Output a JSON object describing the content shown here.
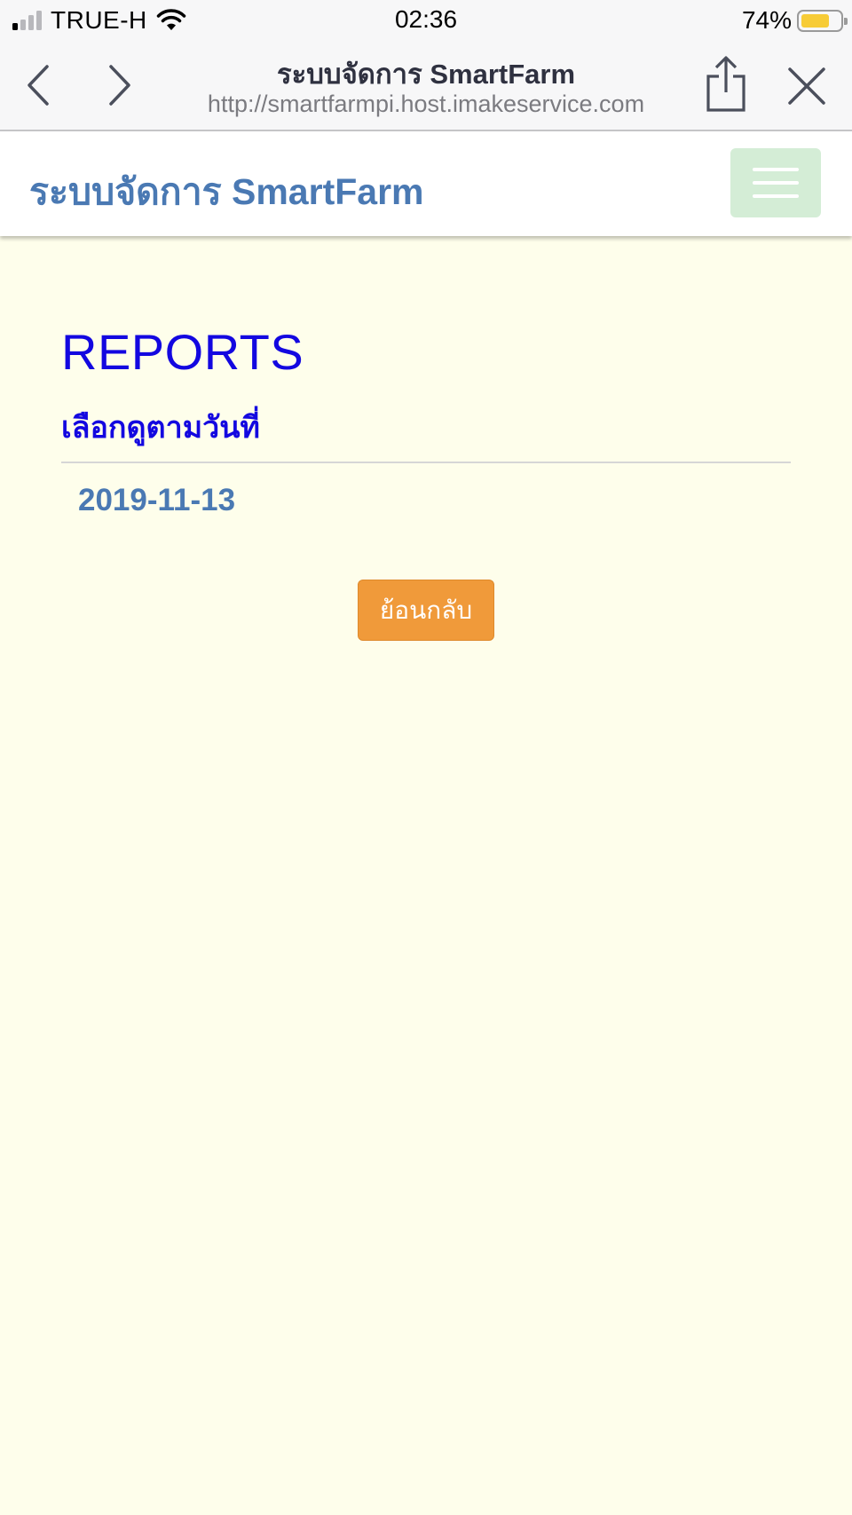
{
  "status_bar": {
    "carrier": "TRUE-H",
    "time": "02:36",
    "battery_percent": "74%",
    "battery_level": 0.74,
    "signal_bars_active": 1,
    "signal_bars_total": 4,
    "icons": [
      "signal-icon",
      "wifi-icon",
      "battery-icon"
    ]
  },
  "browser": {
    "title": "ระบบจัดการ SmartFarm",
    "url": "http://smartfarmpi.host.imakeservice.com",
    "icons": [
      "back-icon",
      "forward-icon",
      "share-icon",
      "close-icon"
    ]
  },
  "site": {
    "brand": "ระบบจัดการ SmartFarm",
    "menu_icon": "hamburger-icon"
  },
  "main": {
    "title": "REPORTS",
    "subtitle": "เลือกดูตามวันที่",
    "dates": [
      "2019-11-13"
    ],
    "back_button_label": "ย้อนกลับ"
  },
  "colors": {
    "page_background": "#fefeeb",
    "brand": "#4a79b3",
    "heading": "#1307e0",
    "button": "#f09a3a",
    "menu_toggle": "#d4edd6"
  }
}
